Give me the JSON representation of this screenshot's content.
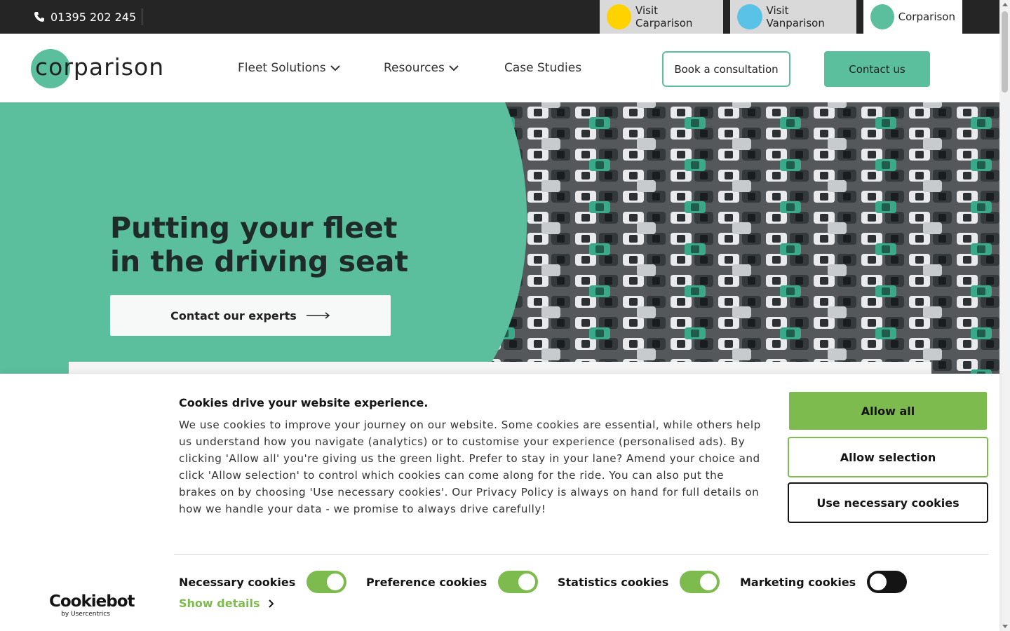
{
  "topbar": {
    "phone": "01395 202 245",
    "sites": [
      {
        "label": "Visit Carparison",
        "color": "#ffd200"
      },
      {
        "label": "Visit Vanparison",
        "color": "#5bc2e7"
      },
      {
        "label": "Corparison",
        "color": "#5bbf9d"
      }
    ]
  },
  "header": {
    "logo_text": "corparison",
    "nav": [
      {
        "label": "Fleet Solutions",
        "has_dropdown": true
      },
      {
        "label": "Resources",
        "has_dropdown": true
      },
      {
        "label": "Case Studies",
        "has_dropdown": false
      }
    ],
    "consult_label": "Book a consultation",
    "contact_label": "Contact us"
  },
  "hero": {
    "title_line1": "Putting your fleet",
    "title_line2": "in the driving seat",
    "cta_label": "Contact our experts",
    "accent_color": "#5bbf9d"
  },
  "cookie_banner": {
    "title": "Cookies drive your website experience.",
    "body": "We use cookies to improve your journey on our website. Some cookies are essential, while others help us understand how you navigate (analytics) or to customise your experience (personalised ads). By clicking 'Allow all' you're giving us the green light. Prefer to stay in your lane? Amend your choice and click 'Allow selection' to control which cookies can come along for the ride. You can also put the brakes on by choosing 'Use necessary cookies'. Our Privacy Policy is always on hand for full details on how we handle your data - we promise to always drive carefully!",
    "allow_all": "Allow all",
    "allow_selection": "Allow selection",
    "use_necessary": "Use necessary cookies",
    "toggles": [
      {
        "label": "Necessary cookies",
        "on": true
      },
      {
        "label": "Preference cookies",
        "on": true
      },
      {
        "label": "Statistics cookies",
        "on": true
      },
      {
        "label": "Marketing cookies",
        "on": false
      }
    ],
    "show_details": "Show details",
    "brand_name": "Cookiebot",
    "brand_by": "by Usercentrics",
    "accent_color": "#7dbb4f"
  }
}
